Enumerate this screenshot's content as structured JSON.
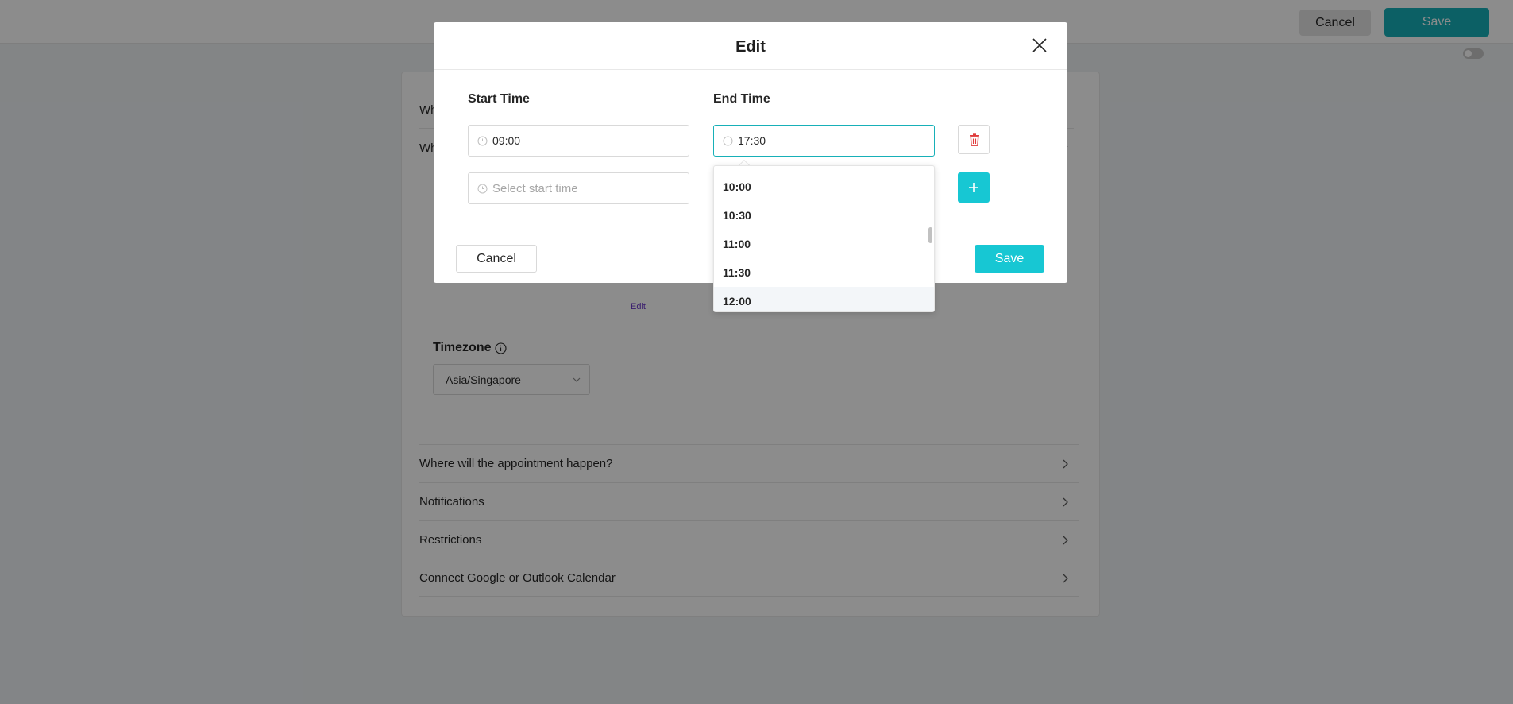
{
  "topbar": {
    "cancel_label": "Cancel",
    "save_label": "Save"
  },
  "background": {
    "peek_rows": [
      "Wh",
      "Wh"
    ],
    "edit_link": "Edit",
    "timezone": {
      "label": "Timezone",
      "value": "Asia/Singapore"
    },
    "sections": [
      "Where will the appointment happen?",
      "Notifications",
      "Restrictions",
      "Connect Google or Outlook Calendar"
    ]
  },
  "modal": {
    "title": "Edit",
    "start_time_label": "Start Time",
    "end_time_label": "End Time",
    "rows": [
      {
        "start": "09:00",
        "end": "17:30"
      }
    ],
    "new_row_start_placeholder": "Select start time",
    "cancel_label": "Cancel",
    "save_label": "Save"
  },
  "dropdown": {
    "options": [
      "10:00",
      "10:30",
      "11:00",
      "11:30",
      "12:00"
    ],
    "hovered": "12:00"
  },
  "colors": {
    "accent": "#17c7d3",
    "danger": "#e03c3c",
    "link": "#6a35c9"
  }
}
